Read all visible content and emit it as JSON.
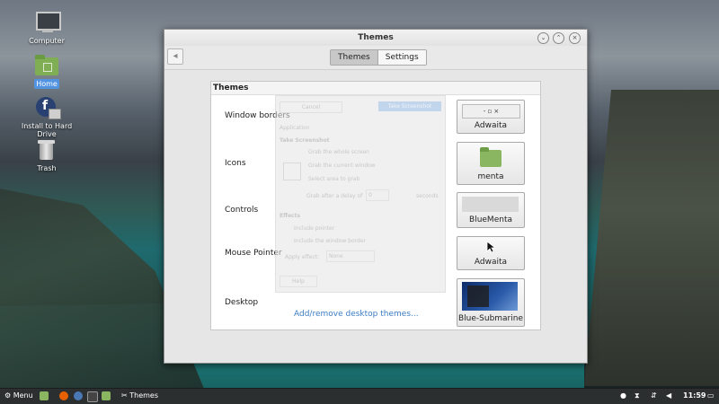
{
  "desktop": {
    "icons": [
      {
        "label": "Computer",
        "icon": "monitor-icon"
      },
      {
        "label": "Home",
        "icon": "home-folder-icon"
      },
      {
        "label": "Install to Hard Drive",
        "icon": "fedora-install-icon"
      },
      {
        "label": "Trash",
        "icon": "trash-icon"
      }
    ]
  },
  "window": {
    "title": "Themes",
    "tabs": [
      "Themes",
      "Settings"
    ],
    "active_tab": "Themes",
    "panel_title": "Themes",
    "rows": [
      {
        "label": "Window borders",
        "theme": "Adwaita"
      },
      {
        "label": "Icons",
        "theme": "menta"
      },
      {
        "label": "Controls",
        "theme": "BlueMenta"
      },
      {
        "label": "Mouse Pointer",
        "theme": "Adwaita"
      },
      {
        "label": "Desktop",
        "theme": "Blue-Submarine"
      }
    ],
    "link": "Add/remove desktop themes...",
    "window_border_buttons": "-   ▫   ×"
  },
  "ghost_dialog": {
    "cancel": "Cancel",
    "take": "Take Screenshot",
    "application": "Application",
    "heading": "Take Screenshot",
    "options": [
      "Grab the whole screen",
      "Grab the current window",
      "Select area to grab"
    ],
    "delay_prefix": "Grab after a delay of",
    "delay_value": "0",
    "delay_suffix": "seconds",
    "effects": "Effects",
    "effect_options": [
      "Include pointer",
      "Include the window border"
    ],
    "apply_effect": "Apply effect:",
    "apply_value": "None",
    "help": "Help"
  },
  "taskbar": {
    "menu": "Menu",
    "task": "Themes",
    "clock": "11:59"
  },
  "colors": {
    "selection": "#5294e2",
    "link": "#3b7dc4",
    "taskbar": "#2c2f30"
  }
}
